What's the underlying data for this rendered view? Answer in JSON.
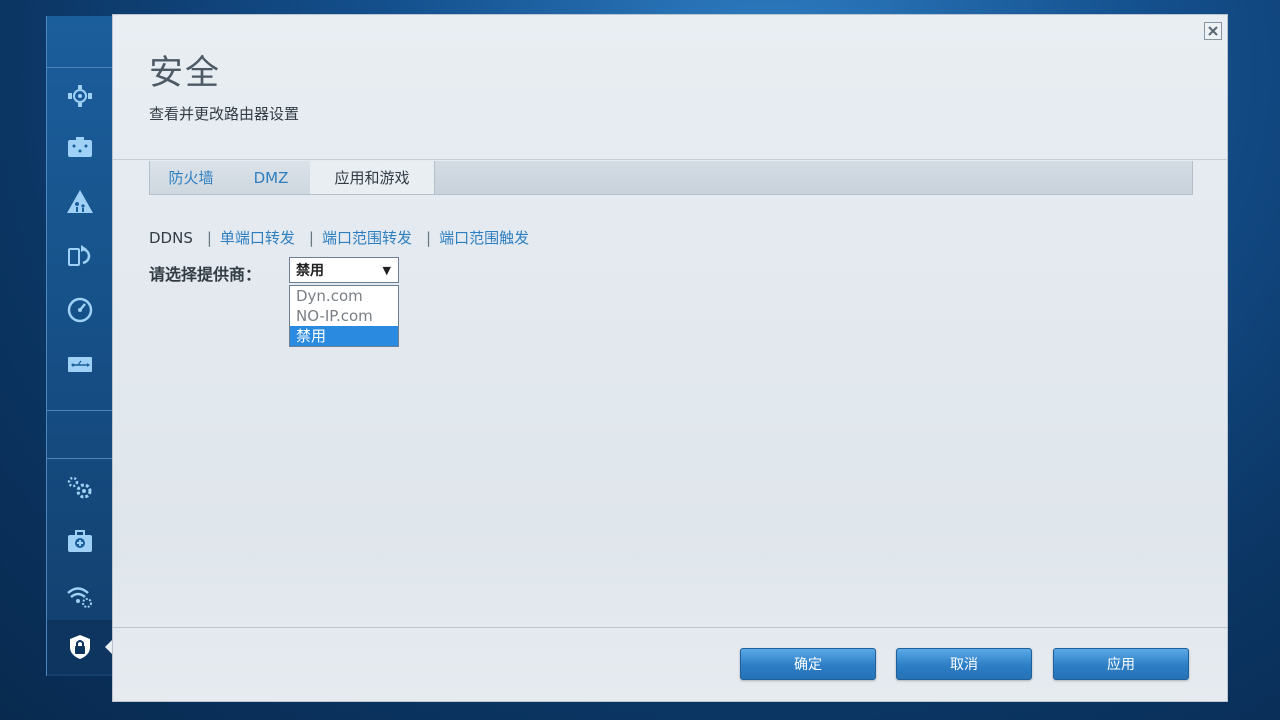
{
  "page": {
    "title": "安全",
    "subtitle": "查看并更改路由器设置"
  },
  "tabs": [
    {
      "label": "防火墙",
      "active": false
    },
    {
      "label": "DMZ",
      "active": false
    },
    {
      "label": "应用和游戏",
      "active": true
    }
  ],
  "sublinks": [
    {
      "label": "DDNS",
      "current": true
    },
    {
      "label": "单端口转发",
      "current": false
    },
    {
      "label": "端口范围转发",
      "current": false
    },
    {
      "label": "端口范围触发",
      "current": false
    }
  ],
  "provider": {
    "label": "请选择提供商：",
    "selected": "禁用",
    "options": [
      "Dyn.com",
      "NO-IP.com",
      "禁用"
    ]
  },
  "buttons": {
    "ok": "确定",
    "cancel": "取消",
    "apply": "应用"
  },
  "sidebar": {
    "icons": [
      "router-status-icon",
      "device-list-icon",
      "parental-controls-icon",
      "media-prioritization-icon",
      "speed-test-icon",
      "usb-storage-icon",
      "connectivity-icon",
      "troubleshooting-icon",
      "wireless-icon",
      "security-icon"
    ],
    "active": "security-icon"
  },
  "colors": {
    "accent": "#2e7fc0",
    "selected_option": "#2a8ae0",
    "button": "#2d7ec5"
  }
}
